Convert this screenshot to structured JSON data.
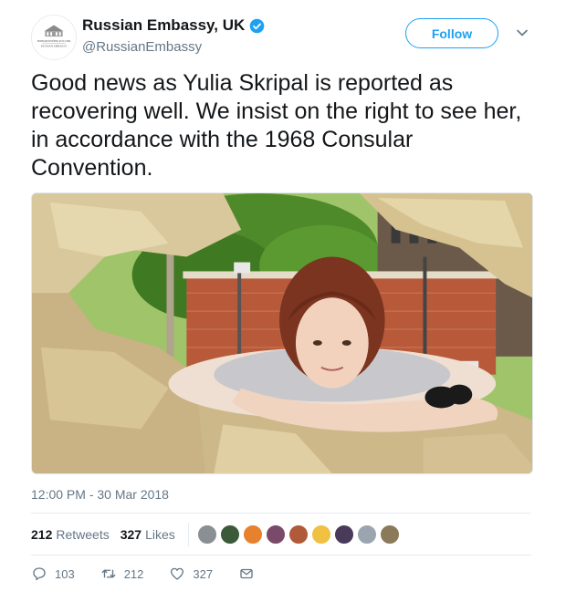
{
  "tweet": {
    "display_name": "Russian Embassy, UK",
    "handle": "@RussianEmbassy",
    "follow_label": "Follow",
    "text": "Good news as Yulia Skripal is reported as recovering well. We insist on the right to see her, in accordance with the 1968 Consular Convention.",
    "timestamp": "12:00 PM - 30 Mar 2018"
  },
  "avatar_text": [
    "НОВОЛИТЕЙНО РОССИИ",
    "RUSSIAN EMBASSY"
  ],
  "stats": {
    "retweets_count": "212",
    "retweets_label": "Retweets",
    "likes_count": "327",
    "likes_label": "Likes"
  },
  "likers": [
    {
      "name": "liker-avatar-1",
      "color": "#8a8f94"
    },
    {
      "name": "liker-avatar-2",
      "color": "#3a5a3a"
    },
    {
      "name": "liker-avatar-3",
      "color": "#e8812e"
    },
    {
      "name": "liker-avatar-4",
      "color": "#7a4a6a"
    },
    {
      "name": "liker-avatar-5",
      "color": "#b05a3a"
    },
    {
      "name": "liker-avatar-6",
      "color": "#f0c040"
    },
    {
      "name": "liker-avatar-7",
      "color": "#4a3a5a"
    },
    {
      "name": "liker-avatar-8",
      "color": "#9aa5b0"
    },
    {
      "name": "liker-avatar-9",
      "color": "#8a7a5a"
    }
  ],
  "actions": {
    "replies": "103",
    "retweets": "212",
    "likes": "327"
  },
  "colors": {
    "accent": "#1da1f2",
    "secondary_text": "#657786",
    "verified": "#1da1f2"
  },
  "icons": {
    "verified": "verified-badge-icon",
    "caret": "chevron-down-icon",
    "reply": "reply-icon",
    "retweet": "retweet-icon",
    "like": "heart-icon",
    "dm": "envelope-icon"
  }
}
